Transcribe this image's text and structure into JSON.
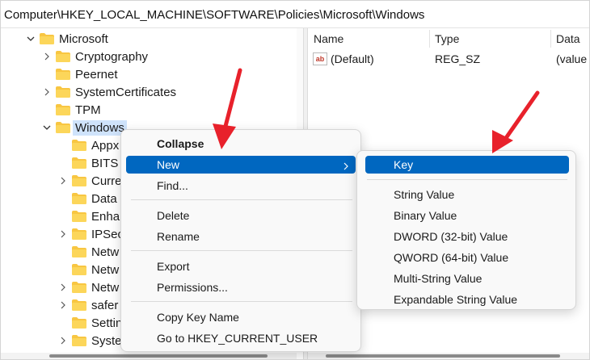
{
  "address": {
    "path": "Computer\\HKEY_LOCAL_MACHINE\\SOFTWARE\\Policies\\Microsoft\\Windows"
  },
  "tree": {
    "items": [
      {
        "label": "Microsoft",
        "expanded": true
      },
      {
        "label": "Cryptography"
      },
      {
        "label": "Peernet"
      },
      {
        "label": "SystemCertificates"
      },
      {
        "label": "TPM"
      },
      {
        "label": "Windows",
        "expanded": true,
        "selected": true
      },
      {
        "label": "Appx"
      },
      {
        "label": "BITS"
      },
      {
        "label": "Curre"
      },
      {
        "label": "Data"
      },
      {
        "label": "Enhar"
      },
      {
        "label": "IPSec"
      },
      {
        "label": "Netw"
      },
      {
        "label": "Netw"
      },
      {
        "label": "Netw"
      },
      {
        "label": "safer"
      },
      {
        "label": "Settin"
      },
      {
        "label": "Syste"
      }
    ]
  },
  "list": {
    "columns": [
      "Name",
      "Type",
      "Data"
    ],
    "rows": [
      {
        "icon": "string-value-icon",
        "icon_text": "ab",
        "name": "(Default)",
        "type": "REG_SZ",
        "data": "(value"
      }
    ]
  },
  "context_menu": {
    "items": {
      "collapse": "Collapse",
      "new": "New",
      "find": "Find...",
      "delete": "Delete",
      "rename": "Rename",
      "export": "Export",
      "permissions": "Permissions...",
      "copy_key_name": "Copy Key Name",
      "goto_hkcu": "Go to HKEY_CURRENT_USER"
    }
  },
  "submenu": {
    "items": {
      "key": "Key",
      "string_value": "String Value",
      "binary_value": "Binary Value",
      "dword_value": "DWORD (32-bit) Value",
      "qword_value": "QWORD (64-bit) Value",
      "multi_string_value": "Multi-String Value",
      "expandable_string_value": "Expandable String Value"
    }
  },
  "colors": {
    "highlight": "#0067c0",
    "folder": "#f8c642",
    "annotation_arrow": "#e8212b",
    "selection": "#cfe3fb"
  }
}
